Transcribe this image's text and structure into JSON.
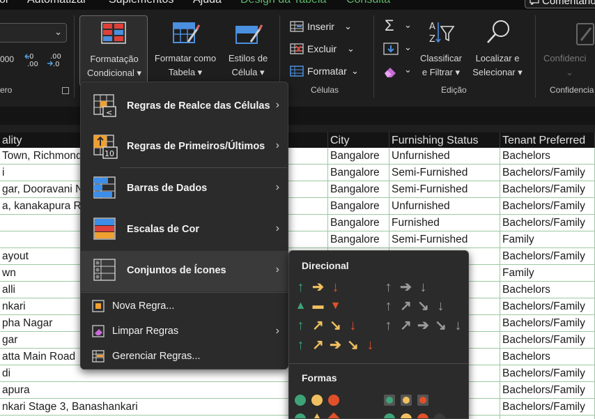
{
  "menubar": {
    "tabs": [
      {
        "label": "ói",
        "green": false
      },
      {
        "label": "Automatizar",
        "green": false
      },
      {
        "label": "Suplementos",
        "green": false
      },
      {
        "label": "Ajuda",
        "green": false
      },
      {
        "label": "Design da Tabela",
        "green": true
      },
      {
        "label": "Consulta",
        "green": true
      }
    ],
    "comments": "Comentários"
  },
  "ribbon": {
    "number_format_value": "000",
    "increase_decimal": "←.0\n.00",
    "decrease_decimal": ".00\n→.0",
    "number_group": "ero",
    "conditional_formatting": [
      "Formatação",
      "Condicional ▾"
    ],
    "format_as_table": [
      "Formatar como",
      "Tabela ▾"
    ],
    "cell_styles": [
      "Estilos de",
      "Célula ▾"
    ],
    "insert": "Inserir",
    "delete": "Excluir",
    "format": "Formatar",
    "cells_group": "Células",
    "sort_filter": [
      "Classificar",
      "e Filtrar ▾"
    ],
    "find_select": [
      "Localizar e",
      "Selecionar ▾"
    ],
    "editing_group": "Edição",
    "sensitivity": "Confidenci",
    "sensitivity_group": "Confidencia"
  },
  "table": {
    "headers": [
      "ality",
      "City",
      "Furnishing Status",
      "Tenant Preferred"
    ],
    "rows": [
      [
        "Town, Richmond",
        "Bangalore",
        "Unfurnished",
        "Bachelors"
      ],
      [
        "i",
        "Bangalore",
        "Semi-Furnished",
        "Bachelors/Family"
      ],
      [
        "gar, Dooravani N",
        "Bangalore",
        "Semi-Furnished",
        "Bachelors/Family"
      ],
      [
        "a, kanakapura Ro",
        "Bangalore",
        "Unfurnished",
        "Bachelors/Family"
      ],
      [
        "",
        "Bangalore",
        "Furnished",
        "Bachelors/Family"
      ],
      [
        "",
        "Bangalore",
        "Semi-Furnished",
        "Family"
      ],
      [
        "ayout",
        "",
        "",
        "Bachelors/Family"
      ],
      [
        "wn",
        "",
        "",
        "Family"
      ],
      [
        "alli",
        "",
        "",
        "Bachelors"
      ],
      [
        "nkari",
        "",
        "",
        "Bachelors/Family"
      ],
      [
        "pha Nagar",
        "",
        "",
        "Bachelors/Family"
      ],
      [
        "gar",
        "",
        "",
        "Bachelors/Family"
      ],
      [
        "atta Main Road",
        "",
        "",
        "Bachelors"
      ],
      [
        "di",
        "",
        "",
        "Bachelors/Family"
      ],
      [
        "apura",
        "",
        "",
        "Bachelors/Family"
      ],
      [
        "nkari Stage 3, Banashankari",
        "",
        "",
        "Bachelors/Family"
      ],
      [
        "",
        "",
        "",
        ""
      ]
    ]
  },
  "cf_menu": {
    "items": [
      {
        "label": "Regras de Realce das Células",
        "icon": "highlight-rules-icon"
      },
      {
        "label": "Regras de Primeiros/Últimos",
        "icon": "top-bottom-rules-icon"
      },
      {
        "label": "Barras de Dados",
        "icon": "data-bars-icon"
      },
      {
        "label": "Escalas de Cor",
        "icon": "color-scales-icon"
      },
      {
        "label": "Conjuntos de Ícones",
        "icon": "icon-sets-icon"
      }
    ],
    "new_rule": "Nova Regra...",
    "clear_rules": "Limpar Regras",
    "manage_rules": "Gerenciar Regras..."
  },
  "icon_submenu": {
    "directional_heading": "Direcional",
    "shapes_heading": "Formas",
    "colors": {
      "green": "#3ea478",
      "yellow": "#f0c060",
      "red": "#e0502a",
      "gray": "#9a9a9a"
    }
  }
}
